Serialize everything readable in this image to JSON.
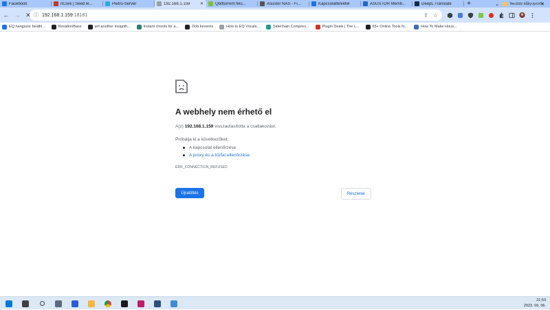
{
  "tabs": [
    {
      "title": "Facebook",
      "color": "#1877f2",
      "active": false
    },
    {
      "title": "nCore | Seed lé...",
      "color": "#c0392b",
      "active": false
    },
    {
      "title": "Pietro-Server",
      "color": "#2ea8e0",
      "active": false
    },
    {
      "title": "192.168.1.159",
      "color": "#9aa0a6",
      "active": true
    },
    {
      "title": "Qbittorrent felü...",
      "color": "#7bbf3b",
      "active": false
    },
    {
      "title": "Asustor NAS - Fi...",
      "color": "#555555",
      "active": false
    },
    {
      "title": "Kapcsolatfelvétel",
      "color": "#1a73e8",
      "active": false
    },
    {
      "title": "ASUSTOR Memb...",
      "color": "#1c66c9",
      "active": false
    },
    {
      "title": "DeepL Translate",
      "color": "#0f2b46",
      "active": false
    }
  ],
  "new_tab_label": "+",
  "window_controls": {
    "minimize": "⌄",
    "restore": "–",
    "maximize": "□",
    "close": "✕"
  },
  "toolbar": {
    "back": "←",
    "forward": "→",
    "reload": "✕",
    "site_info": "ⓘ",
    "url_host": "192.168.1.159",
    "url_port": ":18181",
    "share": "⇪",
    "bookmark_star": "☆"
  },
  "bookmarks": [
    {
      "label": "EQ hangszer beállit...",
      "color": "#1a73e8"
    },
    {
      "label": "NovationBass",
      "color": "#202124"
    },
    {
      "label": "yet another insignifi...",
      "color": "#202124"
    },
    {
      "label": "Instant chords for a...",
      "color": "#2f7d6d"
    },
    {
      "label": "Dob keverés",
      "color": "#202124"
    },
    {
      "label": "How to EQ Vocals...",
      "color": "#9aa0a6"
    },
    {
      "label": "Sidechain Compres...",
      "color": "#1f9e8f"
    },
    {
      "label": "Plugin Deals | The L...",
      "color": "#d93025"
    },
    {
      "label": "65+ Online Tools fo...",
      "color": "#202124"
    },
    {
      "label": "How To Make Hous...",
      "color": "#3d6eb5"
    }
  ],
  "other_bookmarks": "További könyvjelzők",
  "error": {
    "title": "A webhely nem érhető el",
    "desc_prefix": "A(z) ",
    "desc_host": "192.168.1.159",
    "desc_suffix": " visszautasította a csatlakozást.",
    "try_heading": "Próbálja ki a következőket:",
    "suggestions": [
      "A kapcsolat ellenőrzése",
      "A proxy és a tűzfal ellenőrzése"
    ],
    "code": "ERR_CONNECTION_REFUSED",
    "reload_button": "Újratöltés",
    "details_button": "Részletek"
  },
  "taskbar": {
    "apps": [
      {
        "name": "windows-start",
        "color": "#0078d4"
      },
      {
        "name": "task-view",
        "color": "#404040"
      },
      {
        "name": "search",
        "color": "#404040"
      },
      {
        "name": "calculator",
        "color": "#5a6b7d"
      },
      {
        "name": "save-app",
        "color": "#2b5bd7"
      },
      {
        "name": "file-explorer",
        "color": "#f4b73f"
      },
      {
        "name": "chrome",
        "color": "#db4437"
      },
      {
        "name": "steinberg",
        "color": "#1a1a1a"
      },
      {
        "name": "jetbrains",
        "color": "#c21d6a"
      },
      {
        "name": "java-app",
        "color": "#2d4f7c"
      },
      {
        "name": "network-app",
        "color": "#3c8dd4"
      }
    ],
    "time": "21:53",
    "date": "2023. 09. 06."
  }
}
